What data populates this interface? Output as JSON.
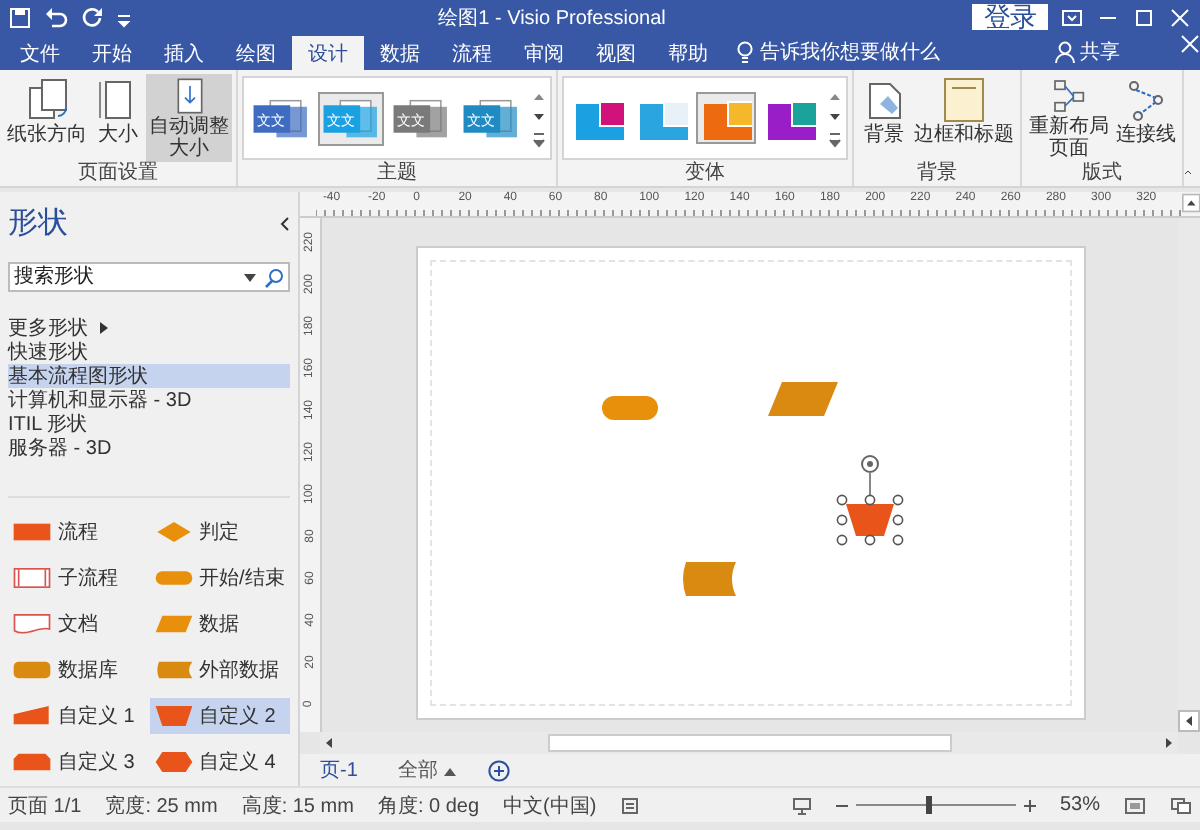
{
  "title_bar": {
    "title": "绘图1  -  Visio Professional",
    "sign_in": "登录"
  },
  "menu_tabs": [
    {
      "label": "文件",
      "selected": false
    },
    {
      "label": "开始",
      "selected": false
    },
    {
      "label": "插入",
      "selected": false
    },
    {
      "label": "绘图",
      "selected": false
    },
    {
      "label": "设计",
      "selected": true
    },
    {
      "label": "数据",
      "selected": false
    },
    {
      "label": "流程",
      "selected": false
    },
    {
      "label": "审阅",
      "selected": false
    },
    {
      "label": "视图",
      "selected": false
    },
    {
      "label": "帮助",
      "selected": false
    }
  ],
  "tell_me": "告诉我你想要做什么",
  "share": "共享",
  "ribbon": {
    "page_setup": {
      "label": "页面设置",
      "buttons": [
        {
          "label": "纸张方向",
          "kind": "orientation",
          "selected": false
        },
        {
          "label": "大小",
          "kind": "size",
          "selected": false
        },
        {
          "label": "自动调整大小",
          "kind": "autosize",
          "selected": true
        }
      ]
    },
    "themes": {
      "label": "主题",
      "items": [
        {
          "text": "文文",
          "color": "#3f6cc0",
          "selected": false
        },
        {
          "text": "文文",
          "color": "#1ba1e2",
          "selected": true
        },
        {
          "text": "文文",
          "color": "#7a7a7a",
          "selected": false
        },
        {
          "text": "文文",
          "color": "#1f8bc2",
          "selected": false
        }
      ]
    },
    "variants": {
      "label": "变体",
      "items": [
        {
          "color": "#1ba1e2",
          "selected": false
        },
        {
          "color": "#2aa5e0",
          "selected": false
        },
        {
          "color": "#ee6a10",
          "selected": true
        },
        {
          "color": "#9a1ec8",
          "selected": false
        }
      ]
    },
    "background": {
      "label": "背景",
      "buttons": [
        {
          "label": "背景",
          "kind": "background"
        },
        {
          "label": "边框和标题",
          "kind": "borders"
        }
      ]
    },
    "layout": {
      "label": "版式",
      "buttons": [
        {
          "label": "重新布局页面",
          "kind": "relayout"
        },
        {
          "label": "连接线",
          "kind": "connectors"
        }
      ]
    }
  },
  "shapes_panel": {
    "title": "形状",
    "search": {
      "placeholder": "搜索形状"
    },
    "stencils": [
      {
        "label": "更多形状",
        "kind": "menu",
        "selected": false
      },
      {
        "label": "快速形状",
        "kind": "stencil",
        "selected": false
      },
      {
        "label": "基本流程图形状",
        "kind": "stencil",
        "selected": true
      },
      {
        "label": "计算机和显示器 - 3D",
        "kind": "stencil",
        "selected": false
      },
      {
        "label": "ITIL 形状",
        "kind": "stencil",
        "selected": false
      },
      {
        "label": "服务器 - 3D",
        "kind": "stencil",
        "selected": false
      }
    ],
    "masters": [
      {
        "label": "流程",
        "kind": "process",
        "selected": false
      },
      {
        "label": "判定",
        "kind": "decision",
        "selected": false
      },
      {
        "label": "子流程",
        "kind": "subprocess",
        "selected": false
      },
      {
        "label": "开始/结束",
        "kind": "terminator",
        "selected": false
      },
      {
        "label": "文档",
        "kind": "document",
        "selected": false
      },
      {
        "label": "数据",
        "kind": "data",
        "selected": false
      },
      {
        "label": "数据库",
        "kind": "database",
        "selected": false
      },
      {
        "label": "外部数据",
        "kind": "external",
        "selected": false
      },
      {
        "label": "自定义 1",
        "kind": "custom1",
        "selected": false
      },
      {
        "label": "自定义 2",
        "kind": "custom2",
        "selected": true
      },
      {
        "label": "自定义 3",
        "kind": "custom3",
        "selected": false
      },
      {
        "label": "自定义 4",
        "kind": "custom4",
        "selected": false
      }
    ]
  },
  "rulers": {
    "horizontal": [
      "-40",
      "-20",
      "0",
      "20",
      "40",
      "60",
      "80",
      "100",
      "120",
      "140",
      "160",
      "180",
      "200",
      "220",
      "240",
      "260",
      "280",
      "300",
      "320"
    ],
    "vertical": [
      "220",
      "200",
      "180",
      "160",
      "140",
      "120",
      "100",
      "80",
      "60",
      "40",
      "20",
      "0"
    ]
  },
  "canvas": {
    "shapes": [
      {
        "kind": "terminator",
        "selected": false
      },
      {
        "kind": "data",
        "selected": false
      },
      {
        "kind": "custom2",
        "selected": true
      },
      {
        "kind": "external",
        "selected": false
      }
    ]
  },
  "page_tabs": {
    "pages": [
      {
        "label": "页-1",
        "selected": true
      }
    ],
    "all": "全部"
  },
  "status_bar": {
    "items": [
      "页面 1/1",
      "宽度: 25 mm",
      "高度: 15 mm",
      "角度: 0 deg",
      "中文(中国)"
    ],
    "zoom": {
      "level": 0.45,
      "reading": "53%"
    }
  }
}
